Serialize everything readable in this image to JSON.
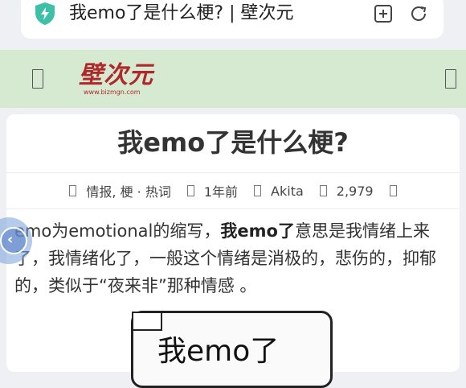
{
  "browser": {
    "url_title": "我emo了是什么梗? | 壁次元"
  },
  "site": {
    "logo_text": "壁次元",
    "logo_url": "www.bizmgn.com"
  },
  "article": {
    "title": "我emo了是什么梗?",
    "meta": {
      "category": "情报, 梗 · 热词",
      "time": "1年前",
      "author": "Akita",
      "views": "2,979"
    },
    "para_pre": "emo为emotional的缩写，",
    "para_bold": "我emo了",
    "para_post": "意思是我情绪上来了，我情绪化了，一般这个情绪是消极的，悲伤的，抑郁的，类似于“夜来非”那种情感 。",
    "image_caption": "我emo了"
  },
  "icons": {
    "shield": "shield-bolt-icon",
    "add_tab": "add-tab-icon",
    "reload": "reload-icon",
    "menu_left": "menu-icon",
    "menu_right": "menu-icon",
    "back": "back-icon"
  },
  "colors": {
    "header_bg": "#d6ead2",
    "shield": "#3dbfa8",
    "logo": "#b0282a"
  }
}
